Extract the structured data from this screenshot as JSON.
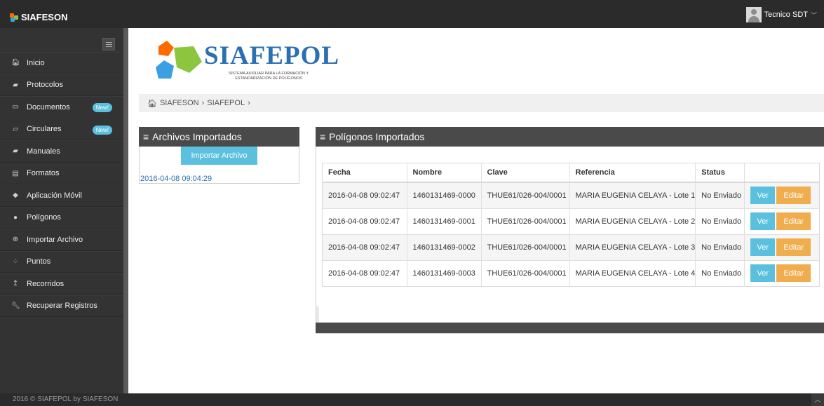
{
  "brand": {
    "name": "SIAFESON",
    "colors": [
      "#ff6a00",
      "#3aa0e0",
      "#8cc63f"
    ]
  },
  "user": {
    "name": "Tecnico SDT"
  },
  "sidebar": {
    "items": [
      {
        "label": "Inicio",
        "icon": "home-icon",
        "glyph": "🏠︎"
      },
      {
        "label": "Protocolos",
        "icon": "book-icon",
        "glyph": "▰"
      },
      {
        "label": "Documentos",
        "icon": "folder-icon",
        "glyph": "▭",
        "badge": "New!"
      },
      {
        "label": "Circulares",
        "icon": "folder-open-icon",
        "glyph": "▱",
        "badge": "New!"
      },
      {
        "label": "Manuales",
        "icon": "book-icon",
        "glyph": "▰"
      },
      {
        "label": "Formatos",
        "icon": "file-icon",
        "glyph": "▤"
      },
      {
        "label": "Aplicación Móvil",
        "icon": "android-icon",
        "glyph": "◆"
      },
      {
        "label": "Polígonos",
        "icon": "circle-icon",
        "glyph": "●"
      },
      {
        "label": "Importar Archivo",
        "icon": "plus-circle-icon",
        "glyph": "⊕"
      },
      {
        "label": "Puntos",
        "icon": "spinner-icon",
        "glyph": "⁘"
      },
      {
        "label": "Recorridos",
        "icon": "level-up-icon",
        "glyph": "↥"
      },
      {
        "label": "Recuperar Registros",
        "icon": "wrench-icon",
        "glyph": "🔧︎"
      }
    ]
  },
  "logo": {
    "title": "SIAFEPOL",
    "subtitle_line1": "SISTEMA AUXILIAR PARA LA FORMACIÓN Y",
    "subtitle_line2": "ESTANDARIZACIÓN DE POLÍGONOS"
  },
  "breadcrumb": {
    "home": "SIAFESON",
    "current": "SIAFEPOL",
    "sep": "›"
  },
  "archivos": {
    "title": "Archivos Importados",
    "import_button": "Importar Archivo",
    "files": [
      "2016-04-08 09:04:29"
    ]
  },
  "poligonos": {
    "title": "Polígonos Importados",
    "columns": [
      "Fecha",
      "Nombre",
      "Clave",
      "Referencia",
      "Status",
      ""
    ],
    "rows": [
      [
        "2016-04-08 09:02:47",
        "1460131469-0000",
        "THUE61/026-004/0001",
        "MARIA EUGENIA CELAYA - Lote 1",
        "No Enviado"
      ],
      [
        "2016-04-08 09:02:47",
        "1460131469-0001",
        "THUE61/026-004/0001",
        "MARIA EUGENIA CELAYA - Lote 2",
        "No Enviado"
      ],
      [
        "2016-04-08 09:02:47",
        "1460131469-0002",
        "THUE61/026-004/0001",
        "MARIA EUGENIA CELAYA - Lote 3",
        "No Enviado"
      ],
      [
        "2016-04-08 09:02:47",
        "1460131469-0003",
        "THUE61/026-004/0001",
        "MARIA EUGENIA CELAYA - Lote 4",
        "No Enviado"
      ]
    ],
    "view_label": "Ver",
    "edit_label": "Editar"
  },
  "footer": {
    "text": "2016 © SIAFEPOL by SIAFESON"
  },
  "colors": {
    "info": "#5bc0de",
    "warning": "#f0ad4e",
    "sidebar": "#333333",
    "header": "#2b2b2b"
  }
}
